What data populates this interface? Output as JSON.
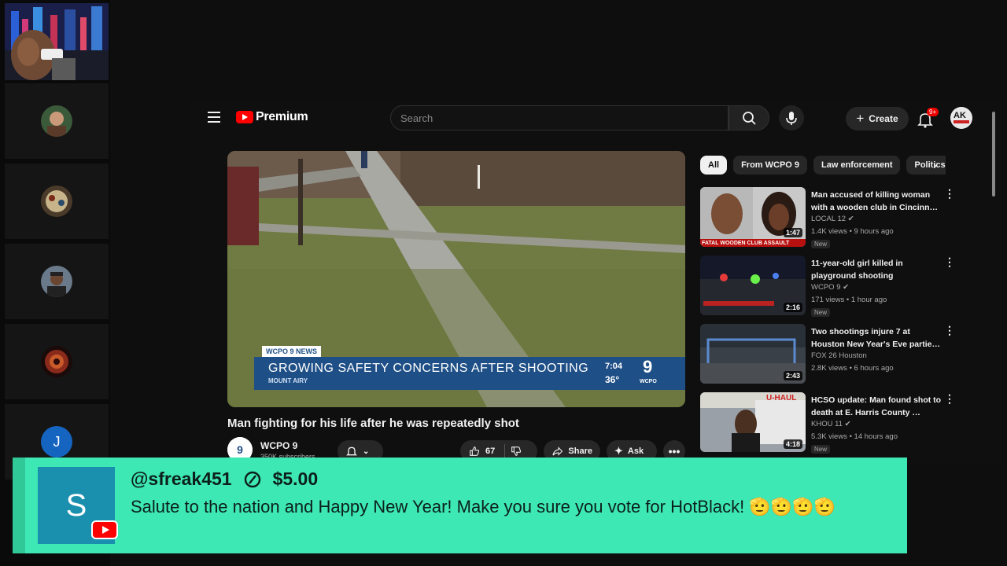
{
  "youtube": {
    "logo_text": "Premium",
    "search_placeholder": "Search",
    "create_label": "Create",
    "notifications_badge": "9+",
    "account_initials": "AK"
  },
  "video": {
    "title": "Man fighting for his life after he was repeatedly shot",
    "lower_third": {
      "tag": "WCPO 9 NEWS",
      "headline": "GROWING SAFETY CONCERNS AFTER SHOOTING",
      "location": "MOUNT AIRY",
      "time": "7:04",
      "temperature": "36°",
      "station_number": "9",
      "station_name": "WCPO"
    },
    "channel": {
      "name": "WCPO 9",
      "subscribers": "350K subscribers"
    },
    "likes": "67",
    "share_label": "Share",
    "ask_label": "Ask"
  },
  "sidebar": {
    "chips": [
      {
        "label": "All",
        "active": true
      },
      {
        "label": "From WCPO 9",
        "active": false
      },
      {
        "label": "Law enforcement",
        "active": false
      },
      {
        "label": "Politics",
        "active": false
      }
    ],
    "recommendations": [
      {
        "title": "Man accused of killing woman with a wooden club in Cincinn…",
        "channel": "LOCAL 12",
        "meta": "1.4K views • 9 hours ago",
        "badge": "New",
        "duration": "1:47",
        "thumb_caption": "FATAL WOODEN CLUB ASSAULT"
      },
      {
        "title": "11-year-old girl killed in playground shooting",
        "channel": "WCPO 9",
        "meta": "171 views • 1 hour ago",
        "badge": "New",
        "duration": "2:16"
      },
      {
        "title": "Two shootings injure 7 at Houston New Year's Eve partie…",
        "channel": "FOX 26 Houston",
        "meta": "2.8K views • 6 hours ago",
        "badge": "",
        "duration": "2:43"
      },
      {
        "title": "HCSO update: Man found shot to death at E. Harris County …",
        "channel": "KHOU 11",
        "meta": "5.3K views • 14 hours ago",
        "badge": "New",
        "duration": "4:18",
        "thumb_caption": "U-HAUL"
      }
    ]
  },
  "participants": {
    "last_initial": "J"
  },
  "superchat": {
    "avatar_letter": "S",
    "username": "@sfreak451",
    "amount": "$5.00",
    "message": "Salute to the nation and Happy New Year! Make you sure you vote for HotBlack! 🫡🫡🫡🫡"
  },
  "colors": {
    "superchat_bg": "#3de8b4",
    "youtube_red": "#ff0000",
    "news_blue": "#1e4f86"
  }
}
